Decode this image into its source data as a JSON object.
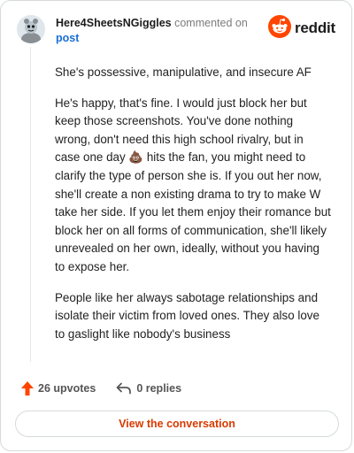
{
  "header": {
    "username": "Here4SheetsNGiggles",
    "commented_on": "commented on",
    "post_link": "post",
    "logo_text": "reddit"
  },
  "comment": {
    "paragraphs": [
      "She's possessive, manipulative, and insecure AF",
      "He's happy, that's fine. I would just block her but keep those screenshots. You've done nothing wrong, don't need this high school rivalry, but in case one day",
      "hits the fan, you might need to clarify the type of person she is. If you out her now, she'll create a non existing drama to try to make W take her side. If you let them enjoy their romance but block her on all forms of communication, she'll likely unrevealed on her own, ideally, without you having to expose her.",
      "People like her always sabotage relationships and isolate their victim from loved ones. They also love to gaslight like nobody's business"
    ],
    "emoji": "💩"
  },
  "actions": {
    "upvotes": "26 upvotes",
    "replies": "0 replies"
  },
  "cta": {
    "label": "View the conversation"
  },
  "colors": {
    "upvote": "#ff4500",
    "link": "#1a6fd6",
    "cta_text": "#d93a00",
    "border": "#d6dadc"
  },
  "icons": [
    "user-avatar-icon",
    "reddit-logo-icon",
    "upvote-arrow-icon",
    "reply-arrow-icon",
    "poop-emoji-icon"
  ]
}
